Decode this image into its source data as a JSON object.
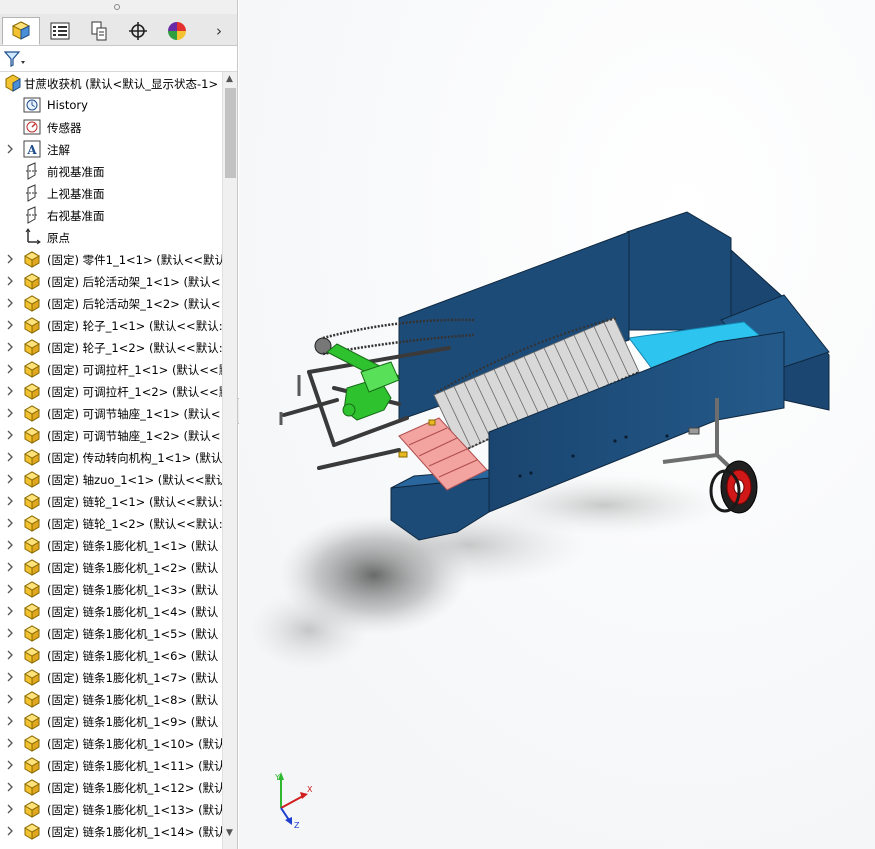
{
  "tabs": [
    {
      "name": "feature-manager-tab",
      "icon": "feature-manager-icon",
      "active": true
    },
    {
      "name": "property-manager-tab",
      "icon": "property-manager-icon",
      "active": false
    },
    {
      "name": "configuration-manager-tab",
      "icon": "configuration-manager-icon",
      "active": false
    },
    {
      "name": "dimxpert-tab",
      "icon": "dimxpert-icon",
      "active": false
    },
    {
      "name": "display-manager-tab",
      "icon": "display-manager-icon",
      "active": false
    }
  ],
  "tabs_more": "›",
  "filter_icon": "filter-icon",
  "tree": {
    "root": "甘蔗收获机 (默认<默认_显示状态-1>",
    "history": "History",
    "sensors": "传感器",
    "annotations": "注解",
    "front_plane": "前视基准面",
    "top_plane": "上视基准面",
    "right_plane": "右视基准面",
    "origin": "原点",
    "components": [
      "(固定) 零件1_1<1> (默认<<默认",
      "(固定) 后轮活动架_1<1> (默认<",
      "(固定) 后轮活动架_1<2> (默认<",
      "(固定) 轮子_1<1> (默认<<默认:",
      "(固定) 轮子_1<2> (默认<<默认:",
      "(固定) 可调拉杆_1<1> (默认<<默",
      "(固定) 可调拉杆_1<2> (默认<<默",
      "(固定) 可调节轴座_1<1> (默认<",
      "(固定) 可调节轴座_1<2> (默认<",
      "(固定) 传动转向机构_1<1> (默认",
      "(固定) 轴zuo_1<1> (默认<<默认",
      "(固定) 链轮_1<1> (默认<<默认:",
      "(固定) 链轮_1<2> (默认<<默认:",
      "(固定) 链条1膨化机_1<1> (默认",
      "(固定) 链条1膨化机_1<2> (默认",
      "(固定) 链条1膨化机_1<3> (默认",
      "(固定) 链条1膨化机_1<4> (默认",
      "(固定) 链条1膨化机_1<5> (默认",
      "(固定) 链条1膨化机_1<6> (默认",
      "(固定) 链条1膨化机_1<7> (默认",
      "(固定) 链条1膨化机_1<8> (默认",
      "(固定) 链条1膨化机_1<9> (默认",
      "(固定) 链条1膨化机_1<10> (默认",
      "(固定) 链条1膨化机_1<11> (默认",
      "(固定) 链条1膨化机_1<12> (默认",
      "(固定) 链条1膨化机_1<13> (默认",
      "(固定) 链条1膨化机_1<14> (默认"
    ]
  },
  "scroll": {
    "up": "▲",
    "down": "▼"
  },
  "collapse_handle": "‹",
  "triad": {
    "x": "X",
    "y": "Y",
    "z": "Z"
  },
  "colors": {
    "body_blue": "#1d4b78",
    "inner_cyan": "#2ec4f0",
    "gearbox_green": "#2fc22f",
    "wheel_red": "#d01818",
    "ramp_pink": "#f4a4a0",
    "part_yellow": "#e8b820"
  }
}
